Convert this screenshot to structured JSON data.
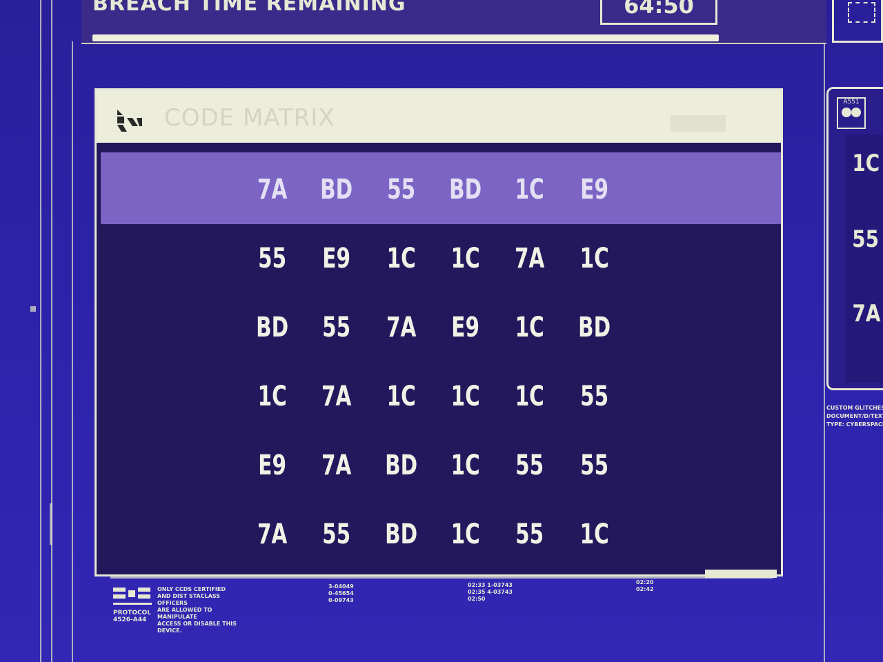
{
  "header": {
    "breach_label": "BREACH TIME REMAINING",
    "timer": "64:50",
    "progress_fraction": 1.0
  },
  "panel": {
    "title": "CODE MATRIX"
  },
  "matrix": {
    "active_row": 0,
    "rows": [
      [
        "7A",
        "BD",
        "55",
        "BD",
        "1C",
        "E9"
      ],
      [
        "55",
        "E9",
        "1C",
        "1C",
        "7A",
        "1C"
      ],
      [
        "BD",
        "55",
        "7A",
        "E9",
        "1C",
        "BD"
      ],
      [
        "1C",
        "7A",
        "1C",
        "1C",
        "1C",
        "55"
      ],
      [
        "E9",
        "7A",
        "BD",
        "1C",
        "55",
        "55"
      ],
      [
        "7A",
        "55",
        "BD",
        "1C",
        "55",
        "1C"
      ]
    ]
  },
  "buffer": {
    "icon_label": "A551",
    "values": [
      "1C",
      "55",
      "7A"
    ],
    "caption_lines": [
      "CUSTOM GLITCHES",
      "DOCUMENT/D/TEXT",
      "TYPE: CYBERSPACE"
    ]
  },
  "footer": {
    "protocol_label": "PROTOCOL",
    "protocol_code": "4526-A44",
    "notes": [
      "ONLY CCDS CERTIFIED",
      "AND DIST STACLASS OFFICERS",
      "ARE ALLOWED TO MANIPULATE",
      "ACCESS OR DISABLE THIS DEVICE."
    ],
    "block1": [
      "3-04049",
      "0-45654",
      "0-09743"
    ],
    "block2": [
      "02:33 1-03743",
      "02:35 4-03743",
      "02:50"
    ],
    "block3": [
      "02:20",
      "02:42"
    ]
  },
  "colors": {
    "background": "#2c22a8",
    "panel_bg": "#23185c",
    "highlight": "#7b64c4",
    "text": "#f1f2e6"
  }
}
